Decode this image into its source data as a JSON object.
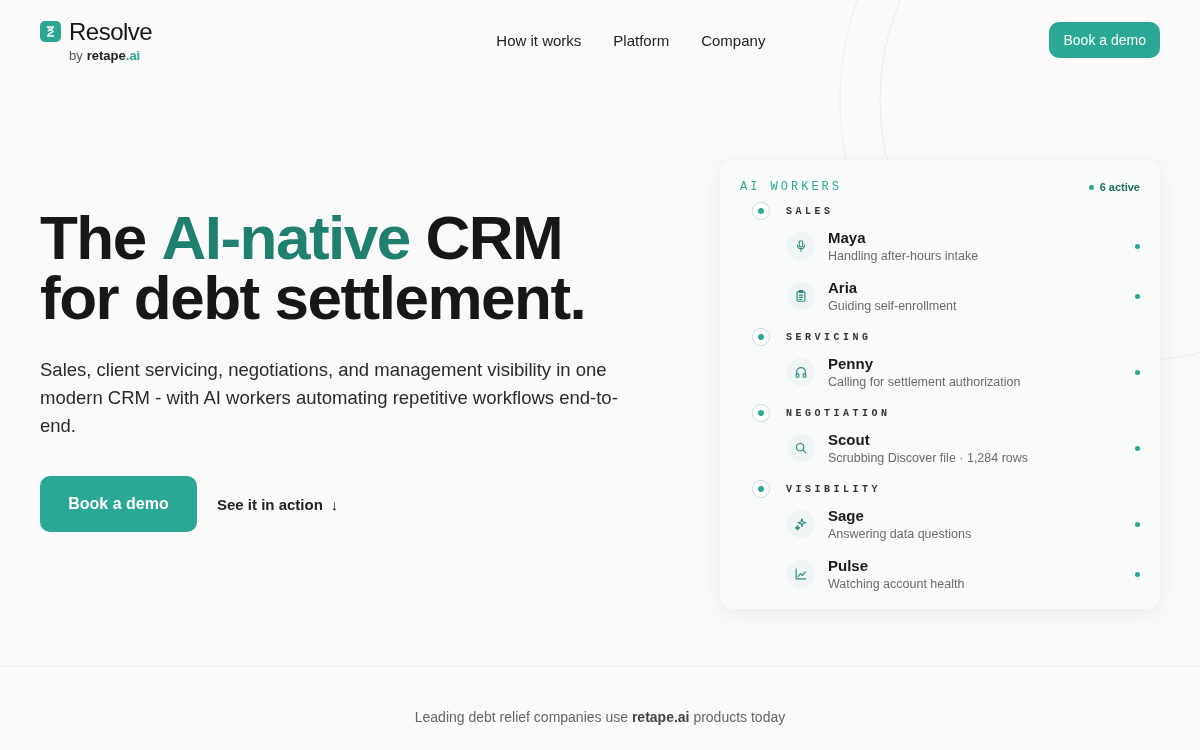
{
  "header": {
    "logo": {
      "name": "Resolve",
      "by": "by",
      "brand": "retape",
      "brand_suffix": ".ai"
    },
    "nav": [
      {
        "label": "How it works"
      },
      {
        "label": "Platform"
      },
      {
        "label": "Company"
      }
    ],
    "cta": "Book a demo"
  },
  "hero": {
    "headline": "The **AI-native** CRM\nfor debt settlement.",
    "subtitle": "Sales, client servicing, negotiations, and management visibility in one modern CRM - with AI workers automating repetitive workflows end-to-end.",
    "primary_button": "Book a demo",
    "secondary_link": "See it in action",
    "secondary_icon": "↓"
  },
  "workers_card": {
    "title": "AI WORKERS",
    "status": "6 active",
    "sections": [
      {
        "name": "SALES",
        "workers": [
          {
            "name": "Maya",
            "task": "Handling after-hours intake",
            "active": true
          },
          {
            "name": "Aria",
            "task": "Guiding self-enrollment",
            "active": true
          }
        ]
      },
      {
        "name": "SERVICING",
        "workers": [
          {
            "name": "Penny",
            "task": "Calling for settlement authorization",
            "active": true
          }
        ]
      },
      {
        "name": "NEGOTIATION",
        "workers": [
          {
            "name": "Scout",
            "task": "Scrubbing Discover file · 1,284 rows",
            "active": true
          }
        ]
      },
      {
        "name": "VISIBILITY",
        "workers": [
          {
            "name": "Sage",
            "task": "Answering data questions",
            "active": true
          },
          {
            "name": "Pulse",
            "task": "Watching account health",
            "active": true
          }
        ]
      }
    ]
  },
  "trust": {
    "text": "Leading debt relief companies use **retape.ai** products today"
  }
}
